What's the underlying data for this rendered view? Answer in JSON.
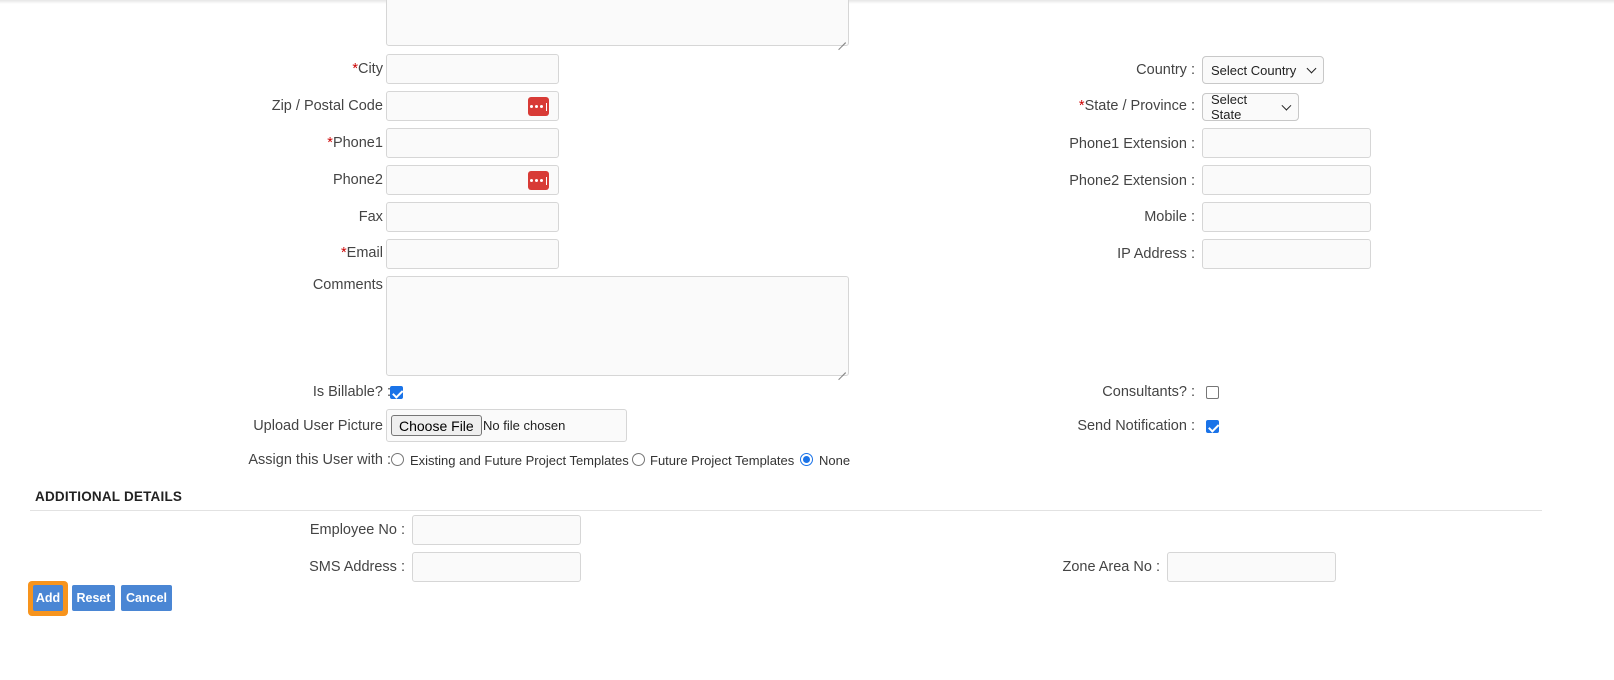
{
  "form": {
    "city_label": "City :",
    "zip_label": "Zip / Postal Code :",
    "phone1_label": "Phone1 :",
    "phone2_label": "Phone2 :",
    "fax_label": "Fax :",
    "email_label": "Email :",
    "comments_label": "Comments :",
    "is_billable_label": "Is Billable? :",
    "upload_label": "Upload User Picture :",
    "assign_label": "Assign this User with :",
    "country_label": "Country :",
    "state_label": "State / Province :",
    "phone1_ext_label": "Phone1 Extension :",
    "phone2_ext_label": "Phone2 Extension :",
    "mobile_label": "Mobile :",
    "ip_label": "IP Address :",
    "consultants_label": "Consultants? :",
    "send_notification_label": "Send Notification :",
    "required_marker": "*",
    "country_select": {
      "selected": "Select Country"
    },
    "state_select": {
      "selected": "Select State"
    },
    "is_billable_checked": true,
    "consultants_checked": false,
    "send_notification_checked": true,
    "file_button": "Choose File",
    "file_status": "No file chosen",
    "assign_options": [
      {
        "label": "Existing and Future Project Templates",
        "selected": false
      },
      {
        "label": "Future Project Templates",
        "selected": false
      },
      {
        "label": "None",
        "selected": true
      }
    ]
  },
  "additional": {
    "title": "ADDITIONAL DETAILS",
    "employee_no_label": "Employee No :",
    "sms_label": "SMS Address :",
    "zone_label": "Zone Area No :"
  },
  "buttons": {
    "add": "Add",
    "reset": "Reset",
    "cancel": "Cancel"
  },
  "colors": {
    "primary_button": "#4a86d4",
    "focus_ring": "#f7941d",
    "required": "#cc0000",
    "password_icon": "#d83b36"
  }
}
